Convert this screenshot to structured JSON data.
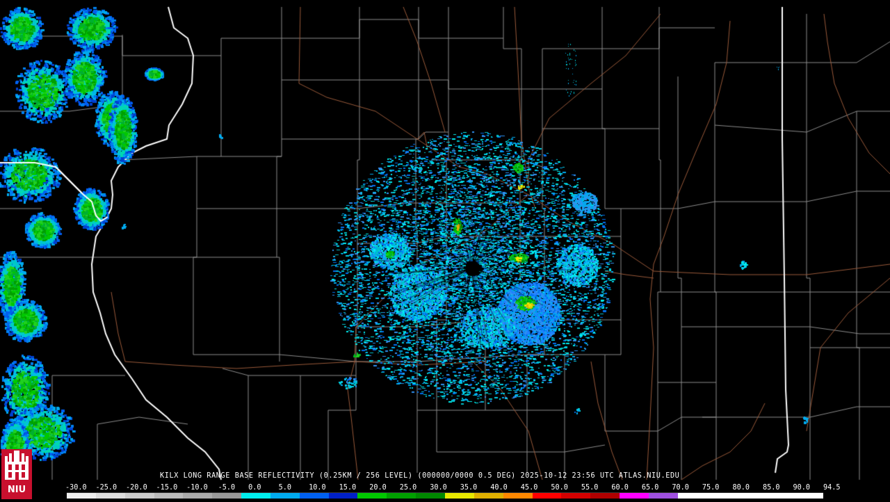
{
  "header": {
    "caption": "KILX LONG RANGE BASE REFLECTIVITY (0.25KM / 256 LEVEL) (000000/0000 0.5 DEG) 2025-10-12 23:56 UTC  ATLAS.NIU.EDU"
  },
  "logo": {
    "text": "NIU",
    "icon": "niu-castle-icon",
    "background": "#c8102e"
  },
  "color_scale": {
    "labels": [
      "-30.0",
      "-25.0",
      "-20.0",
      "-15.0",
      "-10.0",
      "-5.0",
      "0.0",
      "5.0",
      "10.0",
      "15.0",
      "20.0",
      "25.0",
      "30.0",
      "35.0",
      "40.0",
      "45.0",
      "50.0",
      "55.0",
      "60.0",
      "65.0",
      "70.0",
      "75.0",
      "80.0",
      "85.0",
      "90.0",
      "94.5"
    ],
    "colors": [
      "#eeeeee",
      "#dddddd",
      "#cccccc",
      "#bbbbbb",
      "#aaaaaa",
      "#999999",
      "#00eeee",
      "#00aaee",
      "#0060f0",
      "#0020c8",
      "#00c800",
      "#00a000",
      "#008800",
      "#e8e800",
      "#e0b000",
      "#ff8800",
      "#ff0000",
      "#d40000",
      "#b00000",
      "#ff00ff",
      "#a050e0",
      "#ffffff",
      "#ffffff",
      "#ffffff",
      "#ffffff",
      "#ffffff"
    ]
  },
  "map_colors": {
    "background": "#000000",
    "county_lines": "#8c8c8c",
    "state_lines": "#ffffff",
    "roads": "#9a5a3a"
  }
}
